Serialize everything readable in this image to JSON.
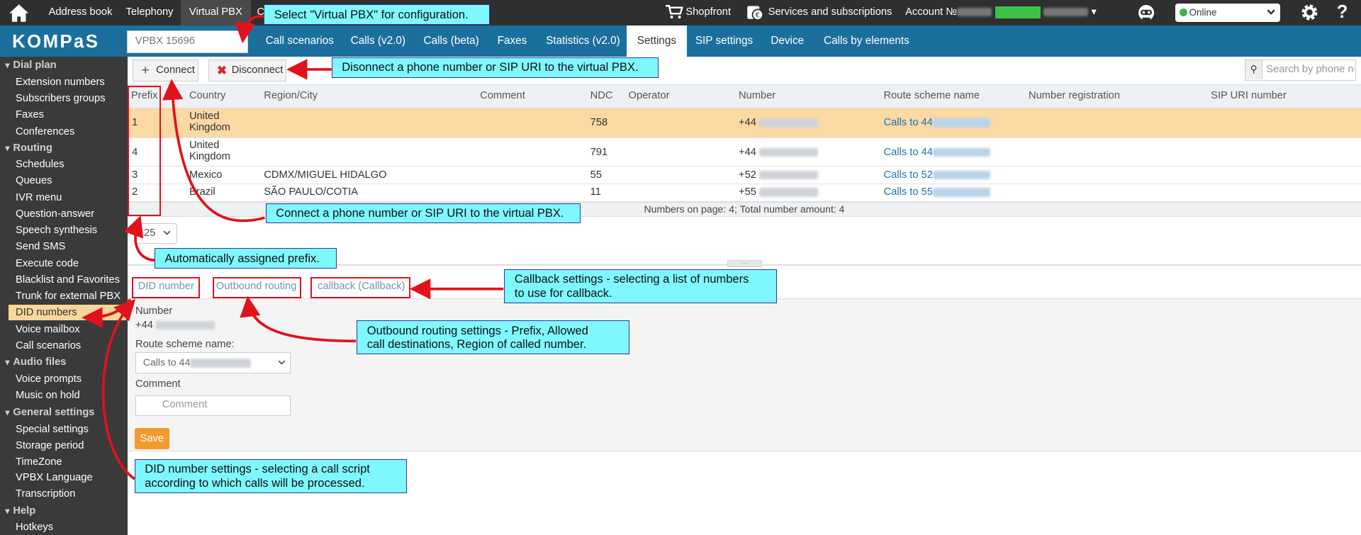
{
  "topbar": {
    "address_book": "Address book",
    "telephony": "Telephony",
    "virtual_pbx": "Virtual PBX",
    "overflow_letter": "C",
    "shopfront": "Shopfront",
    "services": "Services and subscriptions",
    "account_label": "Account №",
    "status": "Online"
  },
  "logo": "KOMPaS",
  "vpbx_selector": "VPBX 15696",
  "nav_tabs": [
    "Call scenarios",
    "Calls (v2.0)",
    "Calls (beta)",
    "Faxes",
    "Statistics (v2.0)",
    "Settings",
    "SIP settings",
    "Device",
    "Calls by elements"
  ],
  "sidebar": {
    "dial_plan": "Dial plan",
    "extension_numbers": "Extension numbers",
    "subscribers_groups": "Subscribers groups",
    "faxes": "Faxes",
    "conferences": "Conferences",
    "routing": "Routing",
    "schedules": "Schedules",
    "queues": "Queues",
    "ivr_menu": "IVR menu",
    "question_answer": "Question-answer",
    "speech_synthesis": "Speech synthesis",
    "send_sms": "Send SMS",
    "execute_code": "Execute code",
    "blacklist": "Blacklist and Favorites",
    "trunk": "Trunk for external PBX",
    "did_numbers": "DID numbers",
    "voice_mailbox": "Voice mailbox",
    "call_scenarios": "Call scenarios",
    "audio_files": "Audio files",
    "voice_prompts": "Voice prompts",
    "music_on_hold": "Music on hold",
    "general_settings": "General settings",
    "special_settings": "Special settings",
    "storage_period": "Storage period",
    "timezone": "TimeZone",
    "vpbx_language": "VPBX Language",
    "transcription": "Transcription",
    "help": "Help",
    "hotkeys": "Hotkeys"
  },
  "toolbar": {
    "connect": "Connect",
    "disconnect": "Disconnect",
    "search_placeholder": "Search by phone num"
  },
  "table": {
    "headers": {
      "prefix": "Prefix",
      "country": "Country",
      "region": "Region/City",
      "comment": "Comment",
      "ndc": "NDC",
      "operator": "Operator",
      "number": "Number",
      "route": "Route scheme name",
      "registration": "Number registration",
      "sip_uri": "SIP URI number"
    },
    "rows": [
      {
        "prefix": "1",
        "country1": "United",
        "country2": "Kingdom",
        "region": "",
        "ndc": "758",
        "number": "+44",
        "route": "Calls to 44"
      },
      {
        "prefix": "4",
        "country1": "United",
        "country2": "Kingdom",
        "region": "",
        "ndc": "791",
        "number": "+44",
        "route": "Calls to 44"
      },
      {
        "prefix": "3",
        "country1": "Mexico",
        "region": "CDMX/MIGUEL HIDALGO",
        "ndc": "55",
        "number": "+52",
        "route": "Calls to 52"
      },
      {
        "prefix": "2",
        "country1": "Brazil",
        "region": "SÃO PAULO/COTIA",
        "ndc": "11",
        "number": "+55",
        "route": "Calls to 55"
      }
    ],
    "footer": "Numbers on page: 4; Total number amount: 4",
    "page_size": "25"
  },
  "subtabs": {
    "did": "DID number",
    "outbound": "Outbound routing",
    "callback": "callback (Callback)"
  },
  "form": {
    "number_label": "Number",
    "number_value": "+44",
    "route_label": "Route scheme name:",
    "route_value": "Calls to 44",
    "comment_label": "Comment",
    "comment_placeholder": "Comment",
    "save": "Save"
  },
  "callouts": {
    "select_vpbx": "Select \"Virtual PBX\" for configuration.",
    "disconnect": "Disonnect a phone number or SIP URI to the virtual PBX.",
    "connect": "Connect a phone number or SIP URI to the virtual PBX.",
    "prefix": "Automatically assigned prefix.",
    "callback_1": "Callback settings - selecting a list of numbers",
    "callback_2": "to use for callback.",
    "outbound_1": "Outbound routing settings - Prefix, Allowed",
    "outbound_2": "call destinations, Region of called number.",
    "did_1": "DID number settings - selecting a call script",
    "did_2": "according to which calls will be processed."
  },
  "colors": {
    "topbar": "#2f2f2f",
    "navbar": "#1b6f9d",
    "sidebar": "#3a3a3a",
    "selected_row": "#fad9a3",
    "callout": "#7ff7ff",
    "annotation_red": "#e0121b",
    "save_button": "#f39b2f",
    "link": "#1a73b5"
  },
  "icons": [
    "home-icon",
    "cart-icon",
    "services-icon",
    "support-icon",
    "gear-icon",
    "help-icon",
    "plus-icon",
    "cross-icon",
    "search-icon",
    "chevron-down-icon"
  ]
}
